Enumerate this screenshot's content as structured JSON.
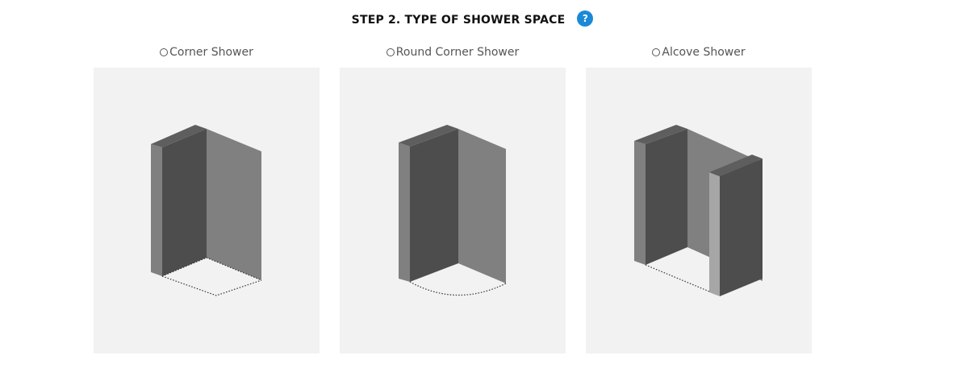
{
  "header": {
    "title": "STEP 2. TYPE OF SHOWER SPACE",
    "help_glyph": "?",
    "help_icon": "question-circle-icon",
    "accent_color": "#1a8ad8"
  },
  "options": [
    {
      "label": "Corner Shower",
      "selected": false,
      "illustration": "corner-shower-icon"
    },
    {
      "label": "Round Corner Shower",
      "selected": false,
      "illustration": "round-corner-shower-icon"
    },
    {
      "label": "Alcove Shower",
      "selected": false,
      "illustration": "alcove-shower-icon"
    }
  ],
  "colors": {
    "panel_background": "#f2f2f2",
    "wall_dark": "#4d4d4d",
    "wall_mid": "#808080",
    "wall_light": "#a6a6a6"
  }
}
